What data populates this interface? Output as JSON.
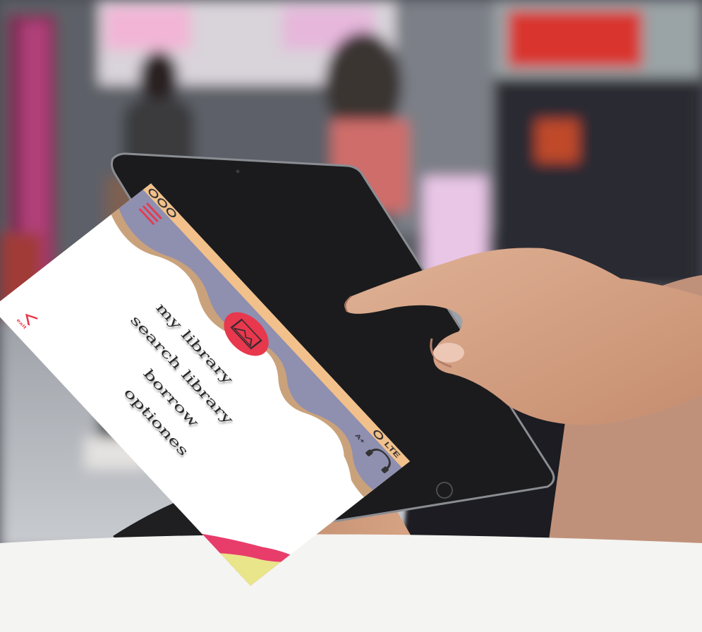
{
  "app": {
    "status_bar": {
      "left_icons": [
        "circle-icon",
        "circle-icon",
        "circle-icon"
      ],
      "right_text": "LTE"
    },
    "header": {
      "font_size_label": "A+",
      "menu_icon": "hamburger-icon",
      "audio_icon": "headphones-icon",
      "logo_icon": "image-icon"
    },
    "menu": [
      {
        "label": "my library"
      },
      {
        "label": "search library"
      },
      {
        "label": "borrow"
      },
      {
        "label": "optiones"
      }
    ],
    "footer": {
      "back_icon": "chevron-left-icon",
      "back_label": "exit"
    },
    "colors": {
      "accent": "#e8384d",
      "header_wave_top": "#f2c08a",
      "header_wave_mid": "#8f8fb0",
      "corner_pink": "#e83c6b",
      "corner_yellow": "#e9e58a"
    }
  }
}
